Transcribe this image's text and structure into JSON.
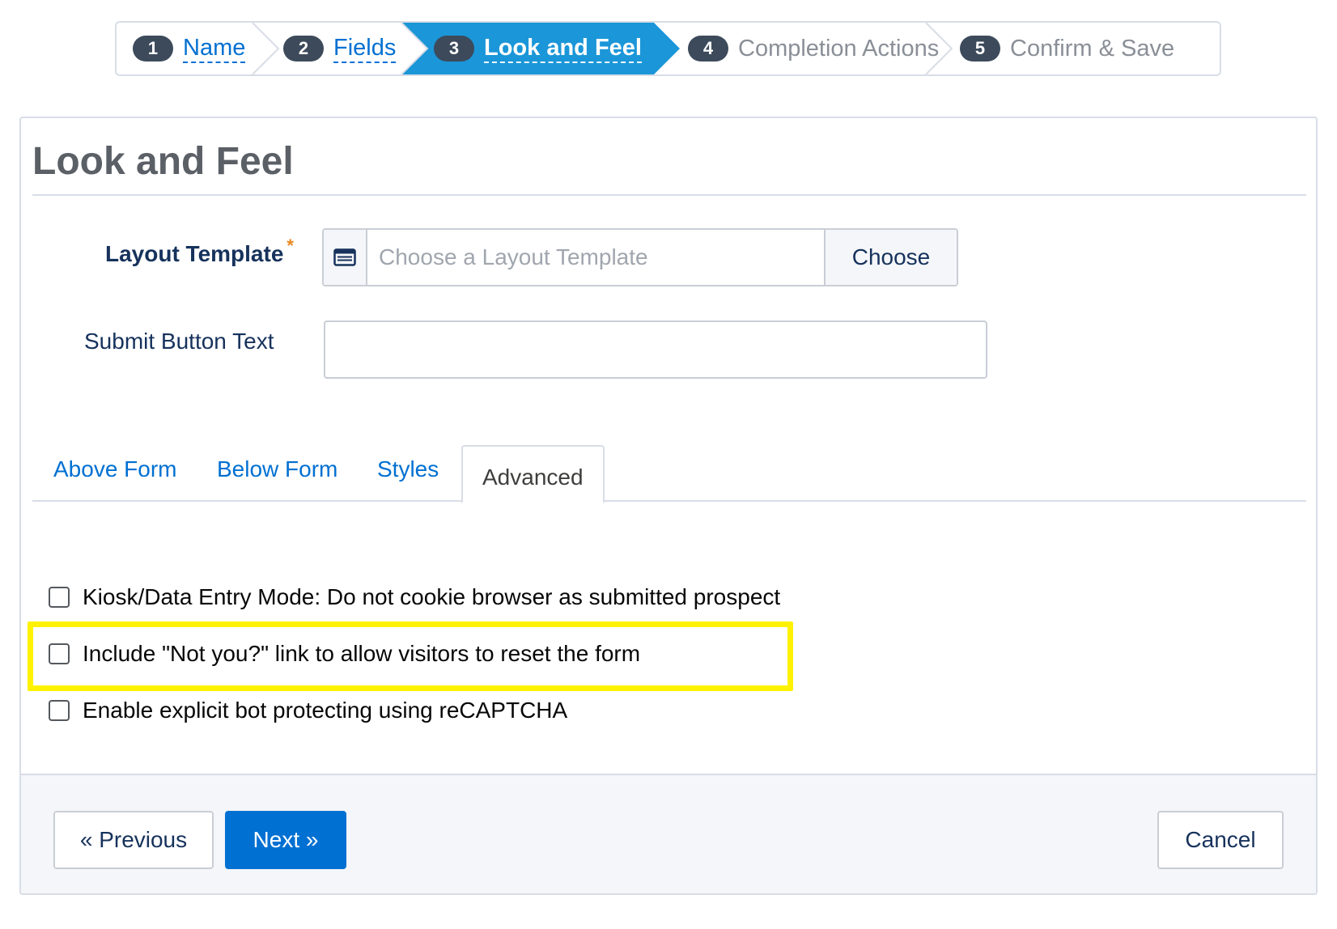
{
  "wizard": {
    "steps": [
      {
        "number": "1",
        "label": "Name",
        "state": "done"
      },
      {
        "number": "2",
        "label": "Fields",
        "state": "done"
      },
      {
        "number": "3",
        "label": "Look and Feel",
        "state": "active"
      },
      {
        "number": "4",
        "label": "Completion Actions",
        "state": "todo"
      },
      {
        "number": "5",
        "label": "Confirm & Save",
        "state": "todo"
      }
    ]
  },
  "card": {
    "title": "Look and Feel"
  },
  "form": {
    "layout_template": {
      "label": "Layout Template",
      "required_marker": "*",
      "placeholder": "Choose a Layout Template",
      "button_label": "Choose",
      "icon": "list-card-icon"
    },
    "submit_button_text": {
      "label": "Submit Button Text",
      "value": ""
    }
  },
  "tabs": [
    {
      "label": "Above Form",
      "active": false
    },
    {
      "label": "Below Form",
      "active": false
    },
    {
      "label": "Styles",
      "active": false
    },
    {
      "label": "Advanced",
      "active": true
    }
  ],
  "advanced": {
    "options": [
      {
        "label": "Kiosk/Data Entry Mode: Do not cookie browser as submitted prospect",
        "checked": false
      },
      {
        "label": "Include \"Not you?\" link to allow visitors to reset the form",
        "checked": false,
        "highlighted": true
      },
      {
        "label": "Enable explicit bot protecting using reCAPTCHA",
        "checked": false
      }
    ]
  },
  "footer": {
    "previous_label": "« Previous",
    "next_label": "Next »",
    "cancel_label": "Cancel"
  },
  "colors": {
    "brand": "#0070d2",
    "active_step": "#1b96d8",
    "highlight": "#fff200",
    "required": "#e8871e"
  }
}
